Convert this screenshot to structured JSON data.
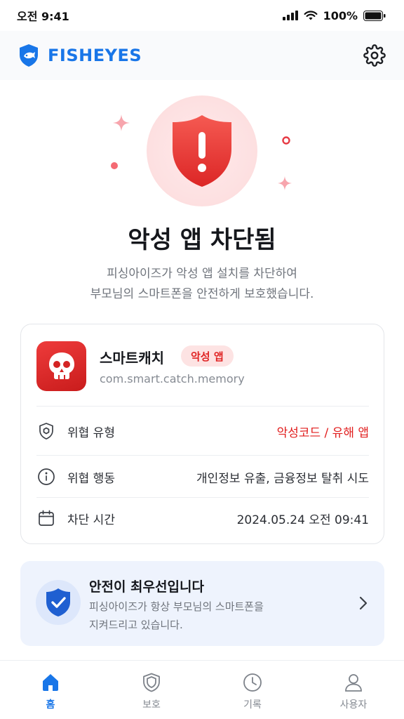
{
  "status_bar": {
    "time": "오전 9:41",
    "battery": "100%"
  },
  "header": {
    "brand": "FISHEYES"
  },
  "alert": {
    "title": "악성 앱 차단됨",
    "description_line1": "피싱아이즈가 악성 앱 설치를 차단하여",
    "description_line2": "부모님의 스마트폰을 안전하게 보호했습니다."
  },
  "app_info": {
    "name": "스마트캐치",
    "badge": "악성 앱",
    "package": "com.smart.catch.memory",
    "rows": [
      {
        "icon": "shield-outline-icon",
        "label": "위협 유형",
        "value": "악성코드 / 유해 앱"
      },
      {
        "icon": "info-icon",
        "label": "위협 행동",
        "value": "개인정보 유출, 금융정보 탈취 시도"
      },
      {
        "icon": "calendar-icon",
        "label": "차단 시간",
        "value": "2024.05.24 오전 09:41"
      }
    ]
  },
  "safety": {
    "title": "안전이 최우선입니다",
    "desc_line1": "피싱아이즈가 항상 부모님의 스마트폰을",
    "desc_line2": "지켜드리고 있습니다."
  },
  "nav": [
    {
      "label": "홈",
      "icon": "home-icon",
      "active": true
    },
    {
      "label": "보호",
      "icon": "shield-icon",
      "active": false
    },
    {
      "label": "기록",
      "icon": "clock-icon",
      "active": false
    },
    {
      "label": "사용자",
      "icon": "user-icon",
      "active": false
    }
  ],
  "colors": {
    "brand": "#1976e8",
    "danger": "#e11d1d",
    "banner": "#eef3fd"
  }
}
